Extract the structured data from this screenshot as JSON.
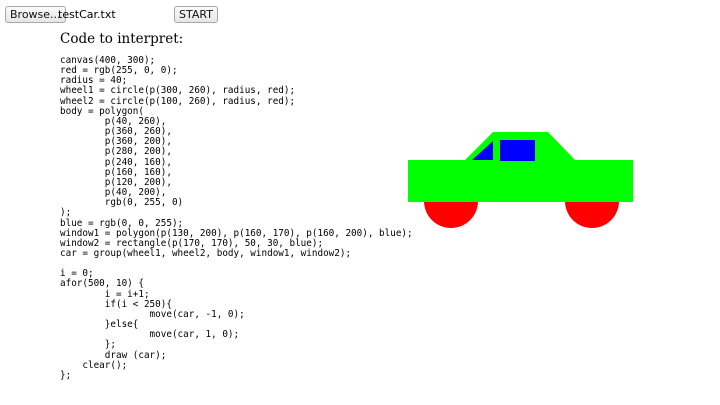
{
  "toolbar": {
    "browse_label": "Browse...",
    "file_name": "testCar.txt",
    "start_label": "START"
  },
  "heading": "Code to interpret:",
  "code": "canvas(400, 300);\nred = rgb(255, 0, 0);\nradius = 40;\nwheel1 = circle(p(300, 260), radius, red);\nwheel2 = circle(p(100, 260), radius, red);\nbody = polygon(\n        p(40, 260),\n        p(360, 260),\n        p(360, 200),\n        p(280, 200),\n        p(240, 160),\n        p(160, 160),\n        p(120, 200),\n        p(40, 200),\n        rgb(0, 255, 0)\n);\nblue = rgb(0, 0, 255);\nwindow1 = polygon(p(130, 200), p(160, 170), p(160, 200), blue);\nwindow2 = rectangle(p(170, 170), 50, 30, blue);\ncar = group(wheel1, wheel2, body, window1, window2);\n\ni = 0;\nafor(500, 10) {\n        i = i+1;\n        if(i < 250){\n                move(car, -1, 0);\n        }else{\n                move(car, 1, 0);\n        };\n        draw (car);\n    clear();\n};",
  "colors": {
    "body": "#00ff00",
    "wheels": "#ff0000",
    "windows": "#0000ff"
  }
}
